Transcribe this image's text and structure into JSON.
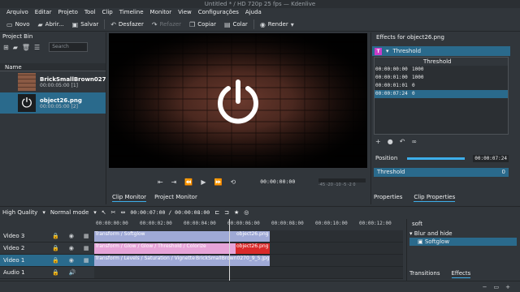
{
  "window": {
    "title": "Untitled * / HD 720p 25 fps — Kdenlive"
  },
  "menu": [
    "Arquivo",
    "Editar",
    "Projeto",
    "Tool",
    "Clip",
    "Timeline",
    "Monitor",
    "View",
    "Configurações",
    "Ajuda"
  ],
  "toolbar": {
    "novo": "Novo",
    "abrir": "Abrir...",
    "salvar": "Salvar",
    "desfazer": "Desfazer",
    "refazer": "Refazer",
    "copiar": "Copiar",
    "colar": "Colar",
    "render": "Render"
  },
  "bin": {
    "title": "Project Bin",
    "search_placeholder": "Search",
    "col_name": "Name",
    "clips": [
      {
        "name": "BrickSmallBrown027",
        "meta": "00:00:05:00 [1]"
      },
      {
        "name": "object26.png",
        "meta": "00:00:05:00 [2]"
      }
    ]
  },
  "monitor": {
    "timecode": "00:00:00:00",
    "meter_labels": "-45  -20  -10  -5  -2  0",
    "tab_clip": "Clip Monitor",
    "tab_project": "Project Monitor"
  },
  "effects": {
    "title": "Effects for object26.png",
    "effect_name": "Threshold",
    "table_header": "Threshold",
    "keyframes": [
      {
        "time": "00:00:00:00",
        "value": "1000"
      },
      {
        "time": "00:00:01:00",
        "value": "1000"
      },
      {
        "time": "00:00:01:01",
        "value": "0"
      },
      {
        "time": "00:00:07:24",
        "value": "0"
      }
    ],
    "position_label": "Position",
    "position_value": "00:00:07:24",
    "param_label": "Threshold",
    "param_value": "0",
    "tab_properties": "Properties",
    "tab_clip_properties": "Clip Properties"
  },
  "timeline": {
    "quality": "High Quality",
    "mode": "Normal mode",
    "timecode": "00:00:07:00 / 00:00:08:00",
    "ruler": [
      "00:00:00:00",
      "00:00:02:00",
      "00:00:04:00",
      "00:00:06:00",
      "00:00:08:00",
      "00:00:10:00",
      "00:00:12:00"
    ],
    "tracks": [
      {
        "name": "Video 3",
        "clips": [
          {
            "label": "Transform / Softglow",
            "color": "#9fa9d6"
          },
          {
            "label": "object26.png",
            "color": "#9fa9d6"
          }
        ]
      },
      {
        "name": "Video 2",
        "clips": [
          {
            "label": "Transform / Glow / Glow / Threshold / Colorize",
            "color": "#e6a4d8"
          },
          {
            "label": "object26.png",
            "color": "#d92a2a"
          }
        ]
      },
      {
        "name": "Video 1",
        "clips": [
          {
            "label": "Transform / Levels / Saturation / Vignette",
            "color": "#9fa9d6"
          },
          {
            "label": "BrickSmallBrown0270_9_5.jpg",
            "color": "#9fa9d6"
          }
        ]
      },
      {
        "name": "Audio 1",
        "clips": []
      }
    ]
  },
  "fx_browser": {
    "search": "soft",
    "group": "Blur and hide",
    "item": "Softglow",
    "tab_transitions": "Transitions",
    "tab_effects": "Effects"
  }
}
